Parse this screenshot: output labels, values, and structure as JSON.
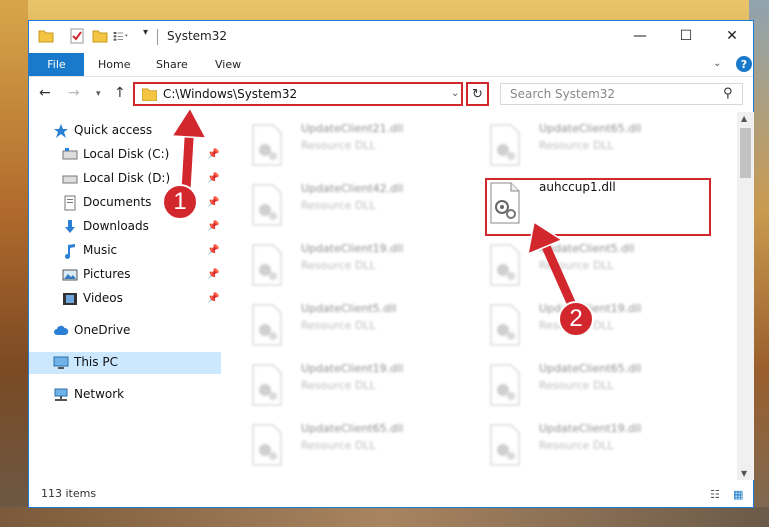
{
  "window": {
    "title": "System32"
  },
  "titlebar_buttons": {
    "minimize": "—",
    "maximize": "☐",
    "close": "✕",
    "qa_dropdown": "▾"
  },
  "ribbon": {
    "tabs": [
      "File",
      "Home",
      "Share",
      "View"
    ],
    "expand": "⌄",
    "help": "?"
  },
  "nav": {
    "back": "←",
    "forward": "→",
    "history": "▾",
    "up": "↑"
  },
  "address": {
    "path": "C:\\Windows\\System32",
    "dropdown": "⌄",
    "refresh": "↻"
  },
  "search": {
    "placeholder": "Search System32",
    "icon": "⚲"
  },
  "sidebar": {
    "items": [
      {
        "label": "Quick access",
        "icon": "star-icon",
        "pinned": false
      },
      {
        "label": "Local Disk (C:)",
        "icon": "drive-icon",
        "pinned": true
      },
      {
        "label": "Local Disk (D:)",
        "icon": "drive-icon",
        "pinned": true
      },
      {
        "label": "Documents",
        "icon": "documents-icon",
        "pinned": true
      },
      {
        "label": "Downloads",
        "icon": "download-icon",
        "pinned": true
      },
      {
        "label": "Music",
        "icon": "music-icon",
        "pinned": true
      },
      {
        "label": "Pictures",
        "icon": "pictures-icon",
        "pinned": true
      },
      {
        "label": "Videos",
        "icon": "videos-icon",
        "pinned": true
      },
      {
        "label": "OneDrive",
        "icon": "cloud-icon",
        "pinned": false
      },
      {
        "label": "This PC",
        "icon": "computer-icon",
        "pinned": false,
        "selected": true
      },
      {
        "label": "Network",
        "icon": "network-icon",
        "pinned": false
      }
    ],
    "pin_glyph": "📌"
  },
  "files": {
    "left_column": [
      {
        "name": "UpdateClient21.dll",
        "desc": "Resource DLL"
      },
      {
        "name": "UpdateClient42.dll",
        "desc": "Resource DLL"
      },
      {
        "name": "UpdateClient19.dll",
        "desc": "Resource DLL"
      },
      {
        "name": "UpdateClient5.dll",
        "desc": "Resource DLL"
      },
      {
        "name": "UpdateClient19.dll",
        "desc": "Resource DLL"
      },
      {
        "name": "UpdateClient65.dll",
        "desc": "Resource DLL"
      }
    ],
    "right_column": [
      {
        "name": "UpdateClient65.dll",
        "desc": "Resource DLL"
      },
      {
        "name": "auhccup1.dll",
        "desc": ""
      },
      {
        "name": "UpdateClient5.dll",
        "desc": "Resource DLL"
      },
      {
        "name": "UpdateClient19.dll",
        "desc": "Resource DLL"
      },
      {
        "name": "UpdateClient65.dll",
        "desc": "Resource DLL"
      },
      {
        "name": "UpdateClient19.dll",
        "desc": "Resource DLL"
      }
    ],
    "highlighted": "auhccup1.dll"
  },
  "status": {
    "count": "113 items"
  },
  "annotations": {
    "step1": "1",
    "step2": "2",
    "color": "#d3272e"
  }
}
